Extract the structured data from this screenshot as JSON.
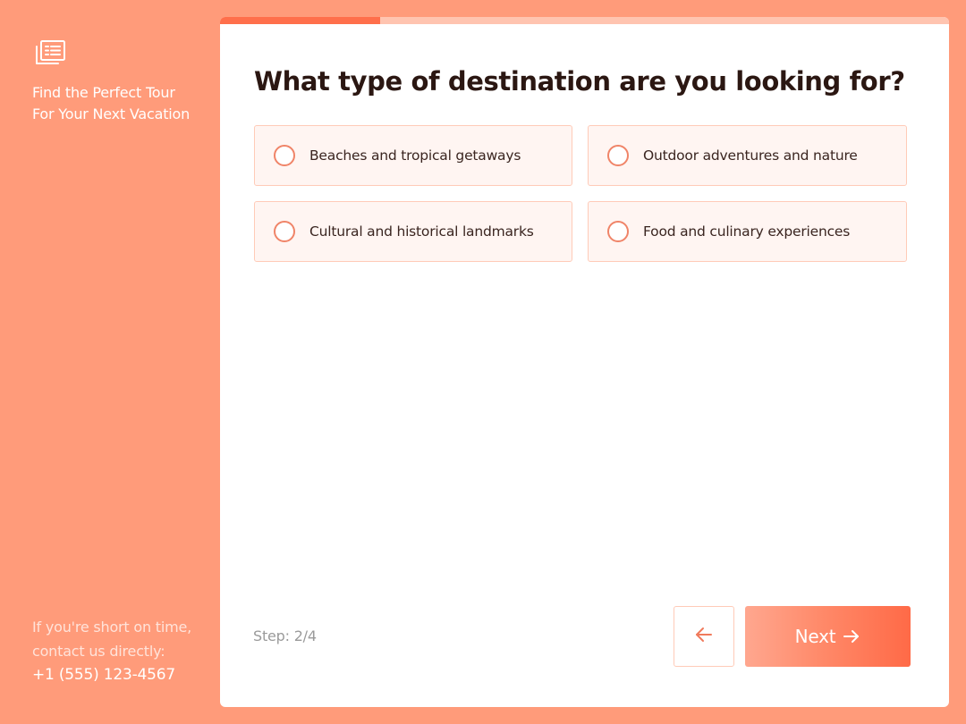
{
  "sidebar": {
    "logo_icon": "document-stack-icon",
    "title_line1": "Find the Perfect Tour",
    "title_line2": "For Your Next Vacation",
    "contact_line1": "If you're short on time,",
    "contact_line2": "contact us directly:",
    "phone": "+1 (555) 123-4567"
  },
  "progress": {
    "step": 2,
    "total": 4,
    "fraction": 0.22
  },
  "question": "What type of destination are you looking for?",
  "options": [
    {
      "label": "Beaches and tropical getaways",
      "selected": false
    },
    {
      "label": "Outdoor adventures and nature",
      "selected": false
    },
    {
      "label": "Cultural and historical landmarks",
      "selected": false
    },
    {
      "label": "Food and culinary experiences",
      "selected": false
    }
  ],
  "footer": {
    "step_label": "Step: 2/4",
    "back_icon": "arrow-left-icon",
    "next_label": "Next",
    "next_icon": "arrow-right-icon"
  },
  "colors": {
    "background": "#ff9b7a",
    "accent": "#ff6f4b",
    "option_bg": "#fff5f2",
    "option_border": "#ffcbb8"
  }
}
